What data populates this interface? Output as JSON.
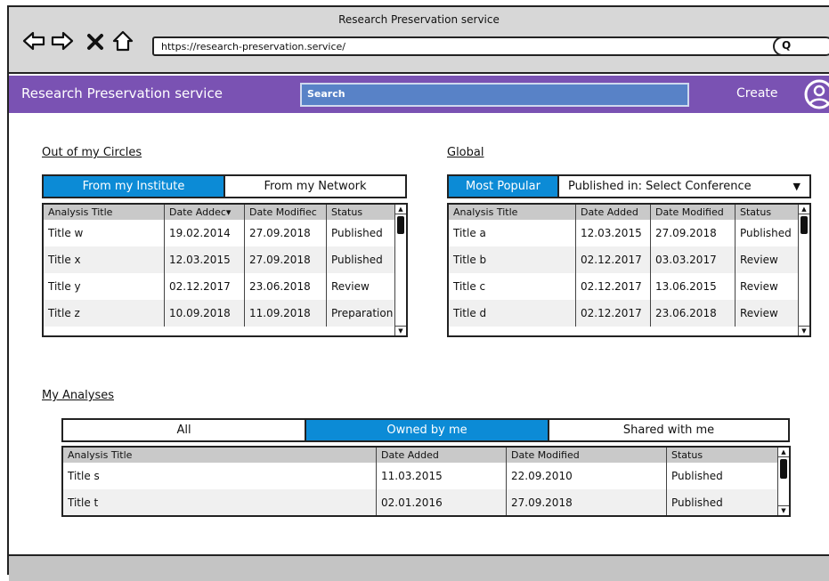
{
  "window": {
    "title": "Research Preservation service"
  },
  "browser": {
    "url": "https://research-preservation.service/",
    "search_icon": "Q"
  },
  "appbar": {
    "brand": "Research Preservation service",
    "search_placeholder": "Search",
    "create_label": "Create"
  },
  "circles": {
    "title": "Out of my Circles",
    "tabs": [
      "From my Institute",
      "From my Network"
    ],
    "columns": [
      "Analysis Title",
      "Date Addec▾",
      "Date Modifiec",
      "Status"
    ],
    "rows": [
      [
        "Title w",
        "19.02.2014",
        "27.09.2018",
        "Published"
      ],
      [
        "Title x",
        "12.03.2015",
        "27.09.2018",
        "Published"
      ],
      [
        "Title y",
        "02.12.2017",
        "23.06.2018",
        "Review"
      ],
      [
        "Title z",
        "10.09.2018",
        "11.09.2018",
        "Preparation"
      ]
    ]
  },
  "global": {
    "title": "Global",
    "tab_active": "Most Popular",
    "dropdown_label": "Published in: Select Conference",
    "columns": [
      "Analysis Title",
      "Date Added",
      "Date Modified",
      "Status"
    ],
    "rows": [
      [
        "Title a",
        "12.03.2015",
        "27.09.2018",
        "Published"
      ],
      [
        "Title b",
        "02.12.2017",
        "03.03.2017",
        "Review"
      ],
      [
        "Title c",
        "02.12.2017",
        "13.06.2015",
        "Review"
      ],
      [
        "Title d",
        "02.12.2017",
        "23.06.2018",
        "Review"
      ]
    ]
  },
  "my_analyses": {
    "title": "My Analyses",
    "tabs": [
      "All",
      "Owned by me",
      "Shared with me"
    ],
    "columns": [
      "Analysis Title",
      "Date Added",
      "Date Modified",
      "Status"
    ],
    "rows": [
      [
        "Title s",
        "11.03.2015",
        "22.09.2010",
        "Published"
      ],
      [
        "Title t",
        "02.01.2016",
        "27.09.2018",
        "Published"
      ]
    ]
  },
  "colors": {
    "appbar": "#7a52b3",
    "active_tab": "#0c8bd6",
    "search": "#5882c7"
  }
}
